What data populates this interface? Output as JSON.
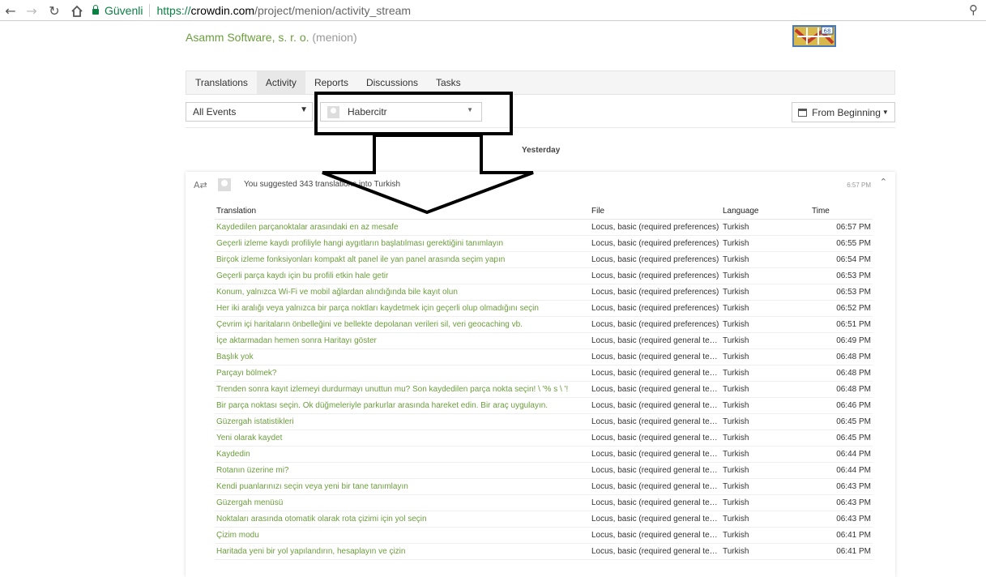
{
  "browser": {
    "secure_label": "Güvenli",
    "url_proto": "https://",
    "url_host": "crowdin.com",
    "url_path": "/project/menion/activity_stream"
  },
  "header": {
    "org": "Asamm Software, s. r. o.",
    "project": "(menion)"
  },
  "tabs": [
    {
      "label": "Translations"
    },
    {
      "label": "Activity"
    },
    {
      "label": "Reports"
    },
    {
      "label": "Discussions"
    },
    {
      "label": "Tasks"
    }
  ],
  "filters": {
    "events": "All Events",
    "user": "Habercitr",
    "date": "From Beginning"
  },
  "date_heading": "Yesterday",
  "activity": {
    "summary": "You suggested 343 translations into Turkish",
    "time": "6:57 PM",
    "columns": {
      "translation": "Translation",
      "file": "File",
      "language": "Language",
      "time": "Time"
    },
    "rows": [
      {
        "translation": "Kaydedilen parçanoktalar arasındaki en az mesafe",
        "file": "Locus, basic (required preferences)",
        "language": "Turkish",
        "time": "06:57 PM"
      },
      {
        "translation": "Geçerli izleme kaydı profiliyle hangi aygıtların başlatılması gerektiğini tanımlayın",
        "file": "Locus, basic (required preferences)",
        "language": "Turkish",
        "time": "06:55 PM"
      },
      {
        "translation": "Birçok izleme fonksiyonları kompakt alt panel ile yan panel arasında seçim yapın",
        "file": "Locus, basic (required preferences)",
        "language": "Turkish",
        "time": "06:54 PM"
      },
      {
        "translation": "Geçerli parça kaydı için bu profili etkin hale getir",
        "file": "Locus, basic (required preferences)",
        "language": "Turkish",
        "time": "06:53 PM"
      },
      {
        "translation": "Konum, yalnızca Wi-Fi ve mobil ağlardan alındığında bile kayıt olun",
        "file": "Locus, basic (required preferences)",
        "language": "Turkish",
        "time": "06:53 PM"
      },
      {
        "translation": "Her iki aralığı veya yalnızca bir parça noktları kaydetmek için geçerli olup olmadığını seçin",
        "file": "Locus, basic (required preferences)",
        "language": "Turkish",
        "time": "06:52 PM"
      },
      {
        "translation": "Çevrim içi haritaların önbelleğini ve bellekte depolanan verileri sil, veri geocaching vb.",
        "file": "Locus, basic (required preferences)",
        "language": "Turkish",
        "time": "06:51 PM"
      },
      {
        "translation": "İçe aktarmadan hemen sonra Haritayı göster",
        "file": "Locus, basic (required general texts)",
        "language": "Turkish",
        "time": "06:49 PM"
      },
      {
        "translation": "Başlık yok",
        "file": "Locus, basic (required general texts)",
        "language": "Turkish",
        "time": "06:48 PM"
      },
      {
        "translation": "Parçayı bölmek?",
        "file": "Locus, basic (required general texts)",
        "language": "Turkish",
        "time": "06:48 PM"
      },
      {
        "translation": "Trenden sonra kayıt izlemeyi durdurmayı unuttun mu? Son kaydedilen parça nokta seçin! \\ '% s \\ '!",
        "file": "Locus, basic (required general texts)",
        "language": "Turkish",
        "time": "06:48 PM"
      },
      {
        "translation": "Bir parça noktası seçin. Ok düğmeleriyle parkurlar arasında hareket edin. Bir araç uygulayın.",
        "file": "Locus, basic (required general texts)",
        "language": "Turkish",
        "time": "06:46 PM"
      },
      {
        "translation": "Güzergah istatistikleri",
        "file": "Locus, basic (required general texts)",
        "language": "Turkish",
        "time": "06:45 PM"
      },
      {
        "translation": "Yeni olarak kaydet",
        "file": "Locus, basic (required general texts)",
        "language": "Turkish",
        "time": "06:45 PM"
      },
      {
        "translation": "Kaydedin",
        "file": "Locus, basic (required general texts)",
        "language": "Turkish",
        "time": "06:44 PM"
      },
      {
        "translation": "Rotanın üzerine mi?",
        "file": "Locus, basic (required general texts)",
        "language": "Turkish",
        "time": "06:44 PM"
      },
      {
        "translation": "Kendi puanlarınızı seçin veya yeni bir tane tanımlayın",
        "file": "Locus, basic (required general texts)",
        "language": "Turkish",
        "time": "06:43 PM"
      },
      {
        "translation": "Güzergah menüsü",
        "file": "Locus, basic (required general texts)",
        "language": "Turkish",
        "time": "06:43 PM"
      },
      {
        "translation": "Noktaları arasında otomatik olarak rota çizimi için yol seçin",
        "file": "Locus, basic (required general texts)",
        "language": "Turkish",
        "time": "06:43 PM"
      },
      {
        "translation": "Çizim modu",
        "file": "Locus, basic (required general texts)",
        "language": "Turkish",
        "time": "06:41 PM"
      },
      {
        "translation": "Haritada yeni bir yol yapılandırın, hesaplayın ve çizin",
        "file": "Locus, basic (required general texts)",
        "language": "Turkish",
        "time": "06:41 PM"
      }
    ]
  }
}
